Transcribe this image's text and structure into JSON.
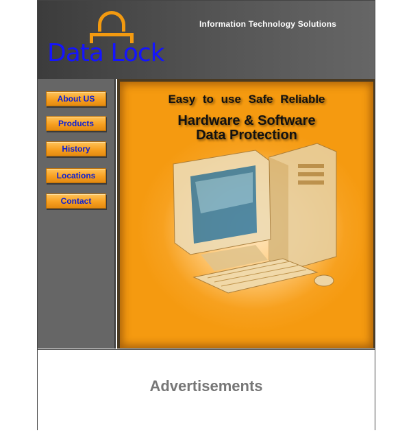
{
  "header": {
    "brand": "Data Lock",
    "tagline": "Information Technology Solutions"
  },
  "nav": {
    "items": [
      {
        "label": "About US"
      },
      {
        "label": "Products"
      },
      {
        "label": "History"
      },
      {
        "label": "Locations"
      },
      {
        "label": "Contact"
      }
    ]
  },
  "hero": {
    "features": "Easy to use    Safe   Reliable",
    "headline_1": "Hardware & Software",
    "headline_2": "Data Protection",
    "image_icon": "desktop-computer-icon"
  },
  "ads": {
    "label": "Advertisements"
  },
  "colors": {
    "accent_orange": "#f7a021",
    "brand_blue": "#1414ff",
    "header_gray": "#555555",
    "sidebar_gray": "#666666"
  }
}
